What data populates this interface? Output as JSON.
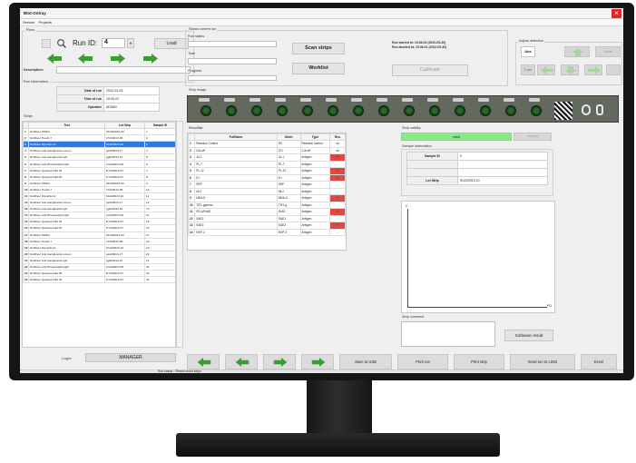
{
  "window": {
    "title": "Blot-Ontray"
  },
  "menu": [
    "Service",
    "Projects"
  ],
  "runs": {
    "group_label": "Runs",
    "run_id_label": "Run ID:",
    "run_id_value": "4",
    "load_label": "Load",
    "description_label": "Description:"
  },
  "run_info": {
    "group_label": "Run information",
    "rows": [
      {
        "label": "Date of run",
        "value": "2022-04-29"
      },
      {
        "label": "Time of run",
        "value": "15:06:22"
      },
      {
        "label": "Operator",
        "value": "ADMIN"
      }
    ]
  },
  "strips": {
    "group_label": "Strips",
    "headers": [
      "Test",
      "Lot Strip",
      "Sample ID"
    ],
    "rows": [
      {
        "n": "1",
        "test": "DotDiver PMScl",
        "lot": "IN1220013-09",
        "sid": "1"
      },
      {
        "n": "2",
        "test": "DotDiver HepAt 7",
        "lot": "LT220013-08",
        "sid": "2"
      },
      {
        "n": "3",
        "test": "DotDiver Myositis 12",
        "lot": "SU220013-10",
        "sid": "3"
      },
      {
        "n": "4",
        "test": "DotDiver Anti-Ganglioside screen",
        "lot": "gs220013-17",
        "sid": "4"
      },
      {
        "n": "5",
        "test": "DotDiver Anti-Ganglioside IgG",
        "lot": "gg220013-16",
        "sid": "5"
      },
      {
        "n": "6",
        "test": "DotDiver Anti-Phospholipid IgM",
        "lot": "pm220013-05",
        "sid": "6"
      },
      {
        "n": "7",
        "test": "DotDiver Quantra ANA 25",
        "lot": "EY220013-07",
        "sid": "7"
      },
      {
        "n": "8",
        "test": "DotDiver Quantra ANA 20",
        "lot": "KY220013-07",
        "sid": "8"
      },
      {
        "n": "9",
        "test": "DotDiver PMScl",
        "lot": "IN1220013-09",
        "sid": "9"
      },
      {
        "n": "10",
        "test": "DotDiver HepAt 7",
        "lot": "LT220013-08",
        "sid": "10"
      },
      {
        "n": "11",
        "test": "DotDiver Myositis 12",
        "lot": "SU220013-10",
        "sid": "11"
      },
      {
        "n": "12",
        "test": "DotDiver Anti-Ganglioside screen",
        "lot": "gs220013-17",
        "sid": "12"
      },
      {
        "n": "13",
        "test": "DotDiver Anti-Ganglioside IgG",
        "lot": "gg220013-16",
        "sid": "13"
      },
      {
        "n": "14",
        "test": "DotDiver Anti-Phospholipid IgM",
        "lot": "pm220013-05",
        "sid": "14"
      },
      {
        "n": "15",
        "test": "DotDiver Quantra ANA 25",
        "lot": "EY220013-07",
        "sid": "15"
      },
      {
        "n": "16",
        "test": "DotDiver Quantra ANA 20",
        "lot": "KY220013-07",
        "sid": "16"
      },
      {
        "n": "17",
        "test": "DotDiver PMScl",
        "lot": "IN1220013-09",
        "sid": "17"
      },
      {
        "n": "18",
        "test": "DotDiver HepAt 7",
        "lot": "LT220013-08",
        "sid": "18"
      },
      {
        "n": "19",
        "test": "DotDiver Myositis 12",
        "lot": "SU220013-10",
        "sid": "19"
      },
      {
        "n": "20",
        "test": "DotDiver Anti-Ganglioside screen",
        "lot": "gs220013-17",
        "sid": "20"
      },
      {
        "n": "21",
        "test": "DotDiver Anti-Ganglioside IgG",
        "lot": "gg220013-16",
        "sid": "21"
      },
      {
        "n": "22",
        "test": "DotDiver Anti-Phospholipid IgM",
        "lot": "pm220013-05",
        "sid": "22"
      },
      {
        "n": "23",
        "test": "DotDiver Quantra ANA 25",
        "lot": "EY220013-07",
        "sid": "23"
      },
      {
        "n": "24",
        "test": "DotDiver Quantra ANA 20",
        "lot": "KY220013-07",
        "sid": "24"
      }
    ],
    "selected_index": 2
  },
  "login": {
    "label": "Login:",
    "value": "MANAGER"
  },
  "status_run": {
    "group_label": "Status current run",
    "run_status_label": "Run status",
    "time_label": "Time",
    "progress_label": "Progress",
    "scan_label": "Scan strips",
    "worklist_label": "Worklist",
    "calibrate_label": "Calibrate",
    "started_line": "Run started at: 15:36:03 (2022-05-30)",
    "aborted_line": "Run aborted at: 15:36:31 (2022-05-30)"
  },
  "adjust": {
    "group_label": "Adjust detection",
    "abs_label": "Abs",
    "rel_label": "Rel",
    "reset_label": "Reset",
    "low_label": "Low"
  },
  "strip_image": {
    "group_label": "Strip image",
    "spot_count": 14
  },
  "results": {
    "group_label": "Resultlist",
    "headers": [
      "FullName",
      "Short",
      "Type",
      "Res."
    ],
    "rows": [
      {
        "n": "1",
        "full": "Reaction Control",
        "short": "RC",
        "type": "Reaction control",
        "res": "ok",
        "pos": false
      },
      {
        "n": "2",
        "full": "Cut-off",
        "short": "CO",
        "type": "Cut-off",
        "res": "ok",
        "pos": false
      },
      {
        "n": "3",
        "full": "Jo-1",
        "short": "Jo-1",
        "type": "Antigen",
        "res": "++",
        "pos": true
      },
      {
        "n": "4",
        "full": "PL-7",
        "short": "PL-7",
        "type": "Antigen",
        "res": "-",
        "pos": false
      },
      {
        "n": "5",
        "full": "PL-12",
        "short": "PL-12",
        "type": "Antigen",
        "res": "+",
        "pos": true
      },
      {
        "n": "6",
        "full": "EJ",
        "short": "EJ",
        "type": "Antigen",
        "res": "+",
        "pos": true
      },
      {
        "n": "7",
        "full": "SRP",
        "short": "SRP",
        "type": "Antigen",
        "res": "-",
        "pos": false
      },
      {
        "n": "8",
        "full": "Mi-2",
        "short": "Mi-2",
        "type": "Antigen",
        "res": "-",
        "pos": false
      },
      {
        "n": "9",
        "full": "MDA-5",
        "short": "MDA-5",
        "type": "Antigen",
        "res": "+",
        "pos": true
      },
      {
        "n": "10",
        "full": "TIF1-gamma",
        "short": "TIF1-g",
        "type": "Antigen",
        "res": "-",
        "pos": false
      },
      {
        "n": "11",
        "full": "SS-A/Ro52",
        "short": "Ro52",
        "type": "Antigen",
        "res": "+",
        "pos": true
      },
      {
        "n": "12",
        "full": "SAE1",
        "short": "SAE1",
        "type": "Antigen",
        "res": "-",
        "pos": false
      },
      {
        "n": "13",
        "full": "SAE2",
        "short": "SAE2",
        "type": "Antigen",
        "res": "+",
        "pos": true
      },
      {
        "n": "14",
        "full": "NXP-2",
        "short": "NXP-2",
        "type": "Antigen",
        "res": "-",
        "pos": false
      }
    ]
  },
  "strip_validity": {
    "group_label": "Strip validity",
    "valid_label": "valid",
    "accept_label": "Accept"
  },
  "sample_info": {
    "group_label": "Sample information",
    "sample_id_label": "Sample ID",
    "sample_id_value": "3",
    "lot_label": "Lot Strip",
    "lot_value": "SU220013-10"
  },
  "plot": {
    "ylabel": "2",
    "xlabel": "PD"
  },
  "strip_comment": {
    "group_label": "Strip comment",
    "software_result_label": "Software result"
  },
  "bottom": {
    "save_usb": "Save to USB",
    "print_run": "Print run",
    "print_strip": "Print strip",
    "send_lims": "Send run to LIMS",
    "excel": "Excel"
  },
  "statusbar": {
    "text": "Run status - Please insert strips"
  },
  "colors": {
    "selected": "#2b7be4",
    "positive": "#e04848",
    "valid": "#86ec86",
    "arrow": "#3c9c34"
  }
}
